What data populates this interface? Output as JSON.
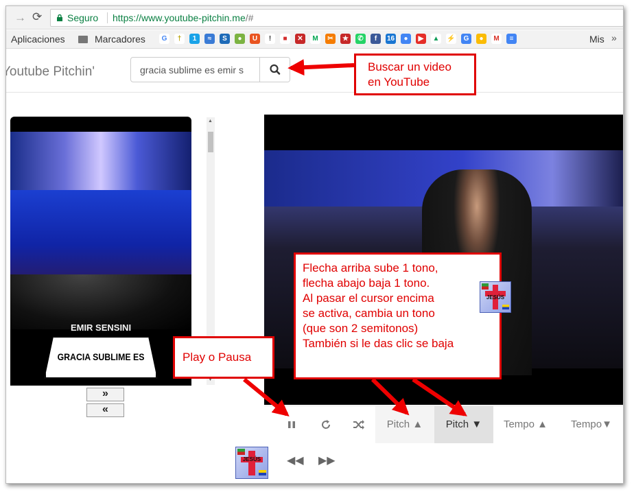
{
  "browser": {
    "secure_label": "Seguro",
    "url_host": "https://www.youtube-pitchin.me",
    "url_path": "/#"
  },
  "bookmarks": {
    "apps_label": "Aplicaciones",
    "folder_label": "Marcadores",
    "mis_label": "Mis",
    "more_label": "»",
    "favicons": [
      {
        "glyph": "G",
        "color": "#ffffff",
        "fg": "#4285f4"
      },
      {
        "glyph": "†",
        "color": "#ffffff",
        "fg": "#b8a100"
      },
      {
        "glyph": "1",
        "color": "#1aa3e8",
        "fg": "#ffffff"
      },
      {
        "glyph": "≈",
        "color": "#3a7bd5",
        "fg": "#ffffff"
      },
      {
        "glyph": "S",
        "color": "#1e6bb8",
        "fg": "#ffffff"
      },
      {
        "glyph": "●",
        "color": "#7cb342",
        "fg": "#ffffff"
      },
      {
        "glyph": "U",
        "color": "#e95420",
        "fg": "#ffffff"
      },
      {
        "glyph": "!",
        "color": "#ffffff",
        "fg": "#333333"
      },
      {
        "glyph": "■",
        "color": "#ffffff",
        "fg": "#d32f2f"
      },
      {
        "glyph": "✕",
        "color": "#c62828",
        "fg": "#ffffff"
      },
      {
        "glyph": "M",
        "color": "#ffffff",
        "fg": "#00a651"
      },
      {
        "glyph": "✂",
        "color": "#f57c00",
        "fg": "#ffffff"
      },
      {
        "glyph": "★",
        "color": "#c62828",
        "fg": "#ffffff"
      },
      {
        "glyph": "✆",
        "color": "#25d366",
        "fg": "#ffffff"
      },
      {
        "glyph": "f",
        "color": "#3b5998",
        "fg": "#ffffff"
      },
      {
        "glyph": "16",
        "color": "#1976d2",
        "fg": "#ffffff"
      },
      {
        "glyph": "●",
        "color": "#4285f4",
        "fg": "#ffffff"
      },
      {
        "glyph": "▶",
        "color": "#e52d27",
        "fg": "#ffffff"
      },
      {
        "glyph": "▲",
        "color": "#ffffff",
        "fg": "#0f9d58"
      },
      {
        "glyph": "⚡",
        "color": "#ffffff",
        "fg": "#2196f3"
      },
      {
        "glyph": "G",
        "color": "#4285f4",
        "fg": "#ffffff"
      },
      {
        "glyph": "●",
        "color": "#fbbc05",
        "fg": "#ffffff"
      },
      {
        "glyph": "M",
        "color": "#ffffff",
        "fg": "#d93025"
      },
      {
        "glyph": "≡",
        "color": "#4285f4",
        "fg": "#ffffff"
      }
    ]
  },
  "header": {
    "brand": "Youtube Pitchin'",
    "search_value": "gracia sublime es emir s"
  },
  "left_list": {
    "artist": "EMIR SENSINI",
    "song": "GRACIA SUBLIME ES",
    "next_label": "»",
    "prev_label": "«"
  },
  "controls": {
    "pitch_up": "Pitch",
    "pitch_down": "Pitch",
    "tempo_up": "Tempo",
    "tempo_down": "Tempo"
  },
  "logo": {
    "text": "JESÚS"
  },
  "annotations": {
    "search_note": [
      "Buscar un video",
      "en YouTube"
    ],
    "play_note": "Play o Pausa",
    "pitch_note": [
      "Flecha arriba sube 1 tono,",
      "flecha abajo baja 1 tono.",
      "Al pasar el cursor encima",
      "se activa, cambia un tono",
      "(que son 2 semitonos)",
      "También si le das clic se baja"
    ]
  },
  "colors": {
    "annotation_red": "#e00000",
    "secure_green": "#0b8043"
  }
}
